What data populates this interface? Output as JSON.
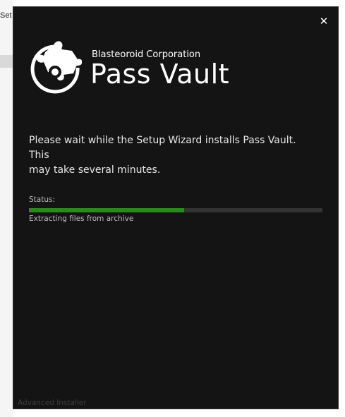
{
  "background": {
    "partial_title": "Set"
  },
  "dialog": {
    "close_glyph": "✕",
    "company": "Blasteoroid Corporation",
    "product": "Pass Vault",
    "message": "Please wait while the Setup Wizard installs Pass Vault.  This\nmay take several minutes.",
    "status_label": "Status:",
    "progress_percent": 53,
    "status_detail": "Extracting files from archive",
    "footer": "Advanced Installer"
  },
  "colors": {
    "dialog_bg": "#141414",
    "progress_fill": "#2b8a1d",
    "progress_track": "#333333"
  },
  "icons": {
    "logo": "puzzle-piece-circle-icon",
    "close": "close-icon"
  }
}
